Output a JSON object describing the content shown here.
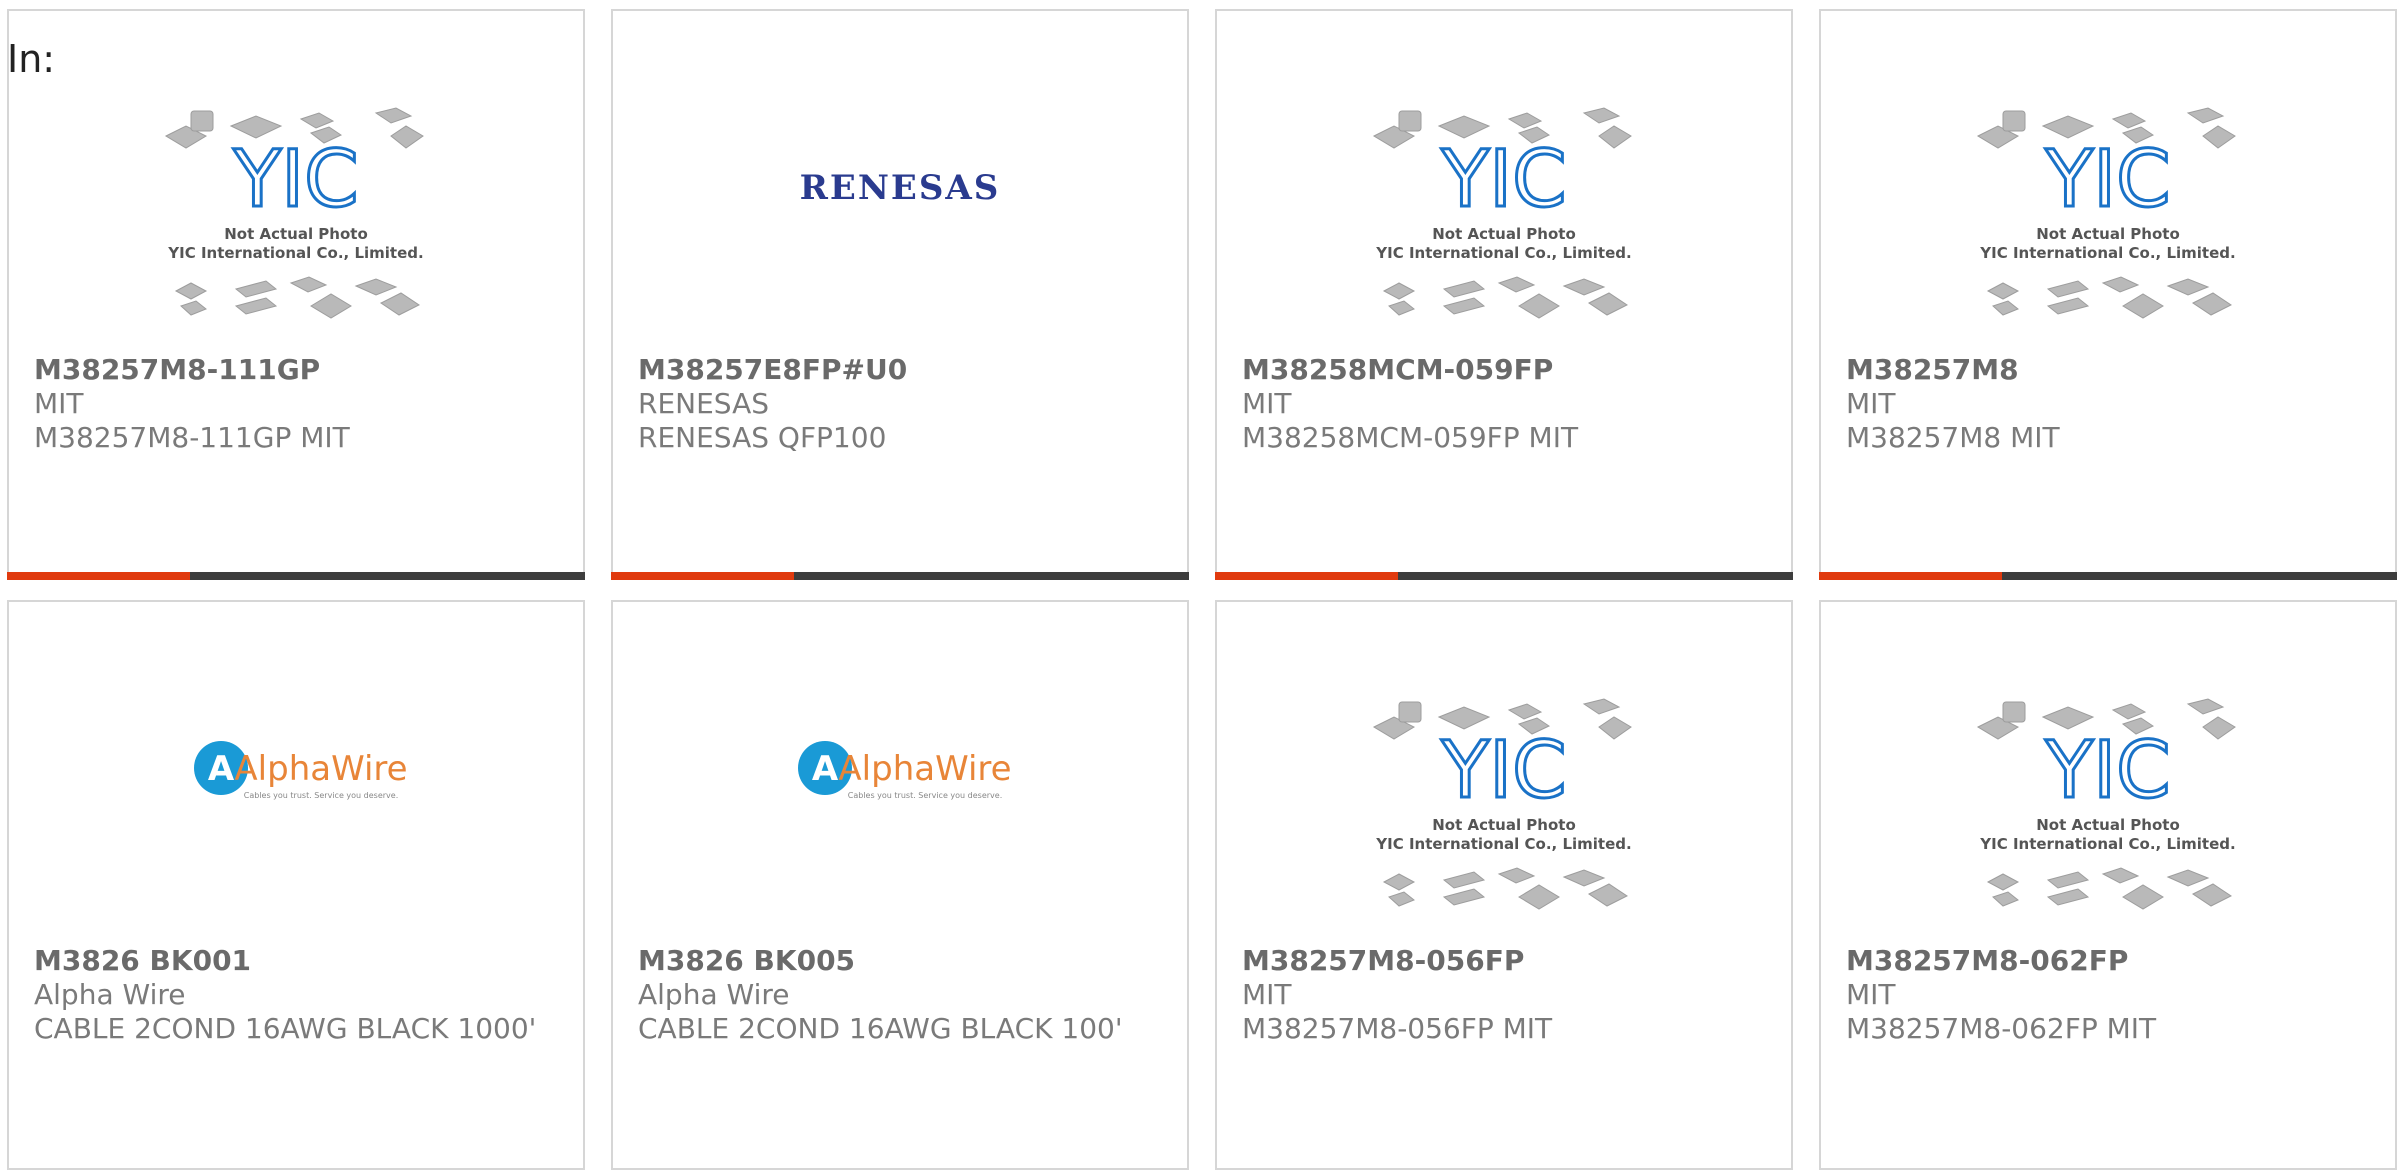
{
  "header": {
    "in_label": "In:"
  },
  "colors": {
    "accent": "#e03a0e",
    "bar": "#3d3d3d",
    "border": "#d6d6d6",
    "text": "#7a7a7a"
  },
  "cards": [
    {
      "part": "M38257M8-111GP",
      "maker": "MIT",
      "desc": "M38257M8-111GP MIT",
      "image": "yic-not-actual-photo"
    },
    {
      "part": "M38257E8FP#U0",
      "maker": "RENESAS",
      "desc": "RENESAS QFP100",
      "image": "renesas-logo",
      "logo_text": "RENESAS"
    },
    {
      "part": "M38258MCM-059FP",
      "maker": "MIT",
      "desc": "M38258MCM-059FP MIT",
      "image": "yic-not-actual-photo"
    },
    {
      "part": "M38257M8",
      "maker": "MIT",
      "desc": "M38257M8 MIT",
      "image": "yic-not-actual-photo"
    },
    {
      "part": "M3826 BK001",
      "maker": "Alpha Wire",
      "desc": "CABLE 2COND 16AWG BLACK 1000'",
      "image": "alphawire-logo",
      "logo_text": "AlphaWire",
      "logo_tagline": "Cables you trust. Service you deserve."
    },
    {
      "part": "M3826 BK005",
      "maker": "Alpha Wire",
      "desc": "CABLE 2COND 16AWG BLACK 100'",
      "image": "alphawire-logo",
      "logo_text": "AlphaWire",
      "logo_tagline": "Cables you trust. Service you deserve."
    },
    {
      "part": "M38257M8-056FP",
      "maker": "MIT",
      "desc": "M38257M8-056FP MIT",
      "image": "yic-not-actual-photo"
    },
    {
      "part": "M38257M8-062FP",
      "maker": "MIT",
      "desc": "M38257M8-062FP MIT",
      "image": "yic-not-actual-photo"
    }
  ],
  "yic": {
    "line1": "Not Actual Photo",
    "line2": "YIC International Co., Limited."
  }
}
